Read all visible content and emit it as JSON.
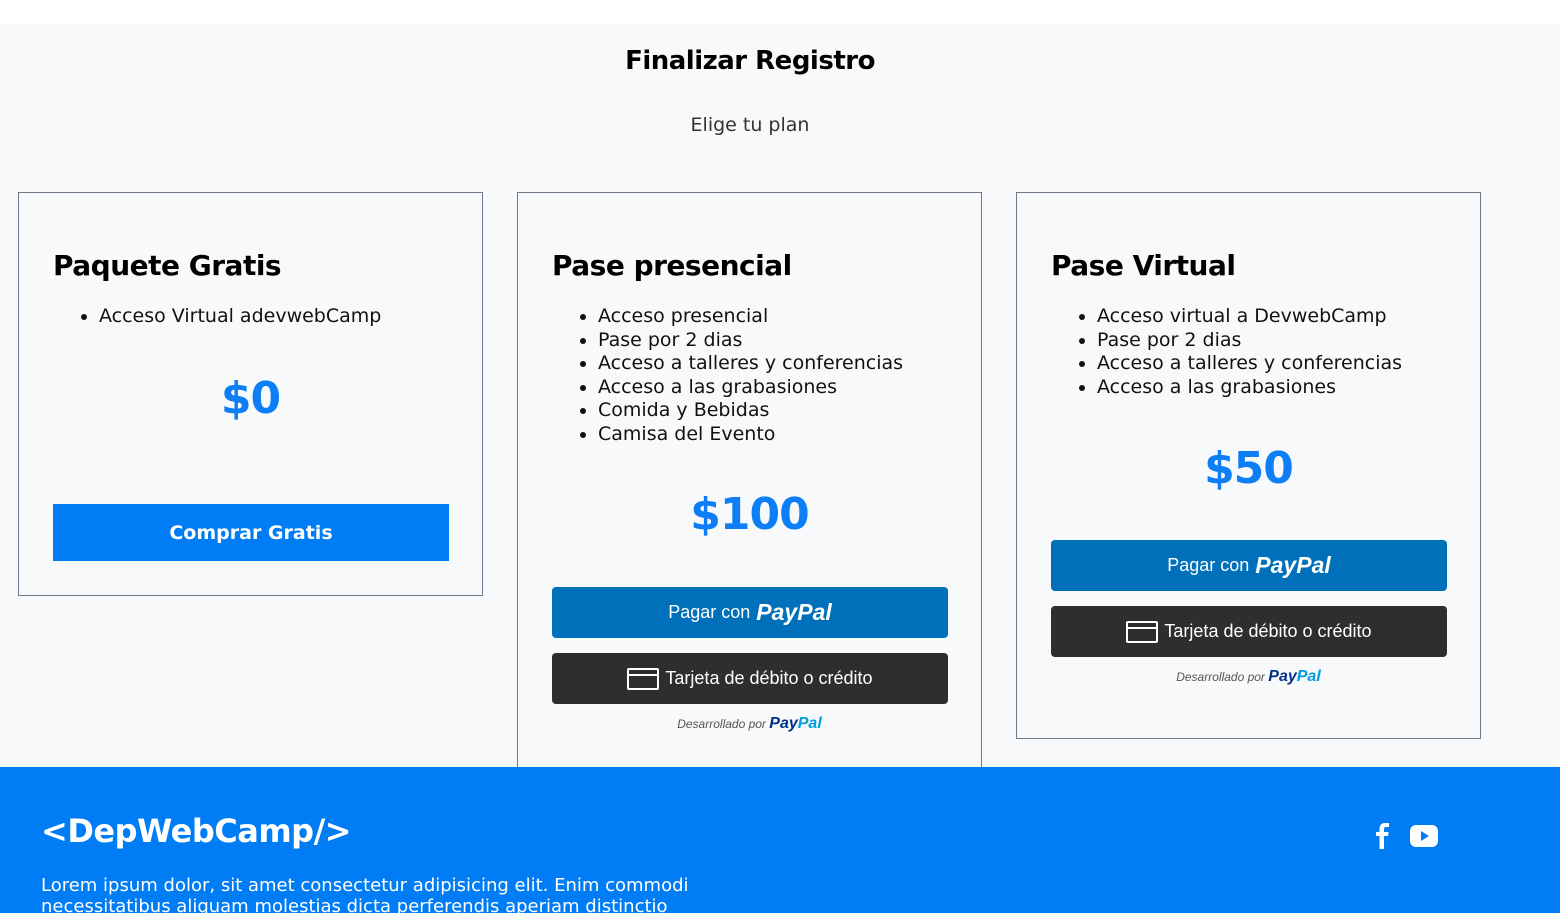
{
  "header": {
    "title": "Finalizar Registro",
    "subtitle": "Elige tu plan"
  },
  "plans": [
    {
      "name": "Paquete Gratis",
      "features": [
        "Acceso Virtual adevwebCamp"
      ],
      "price": "$0",
      "button_label": "Comprar Gratis"
    },
    {
      "name": "Pase presencial",
      "features": [
        "Acceso presencial",
        "Pase por 2 dias",
        "Acceso a talleres y conferencias",
        "Acceso a las grabasiones",
        "Comida y Bebidas",
        "Camisa del Evento"
      ],
      "price": "$100",
      "paypal_label": "Pagar con",
      "paypal_brand_pay": "Pay",
      "paypal_brand_pal": "Pal",
      "card_label": "Tarjeta de débito o crédito",
      "powered_label": "Desarrollado por"
    },
    {
      "name": "Pase Virtual",
      "features": [
        "Acceso virtual a DevwebCamp",
        "Pase por 2 dias",
        "Acceso a talleres y conferencias",
        "Acceso a las grabasiones"
      ],
      "price": "$50",
      "paypal_label": "Pagar con",
      "paypal_brand_pay": "Pay",
      "paypal_brand_pal": "Pal",
      "card_label": "Tarjeta de débito o crédito",
      "powered_label": "Desarrollado por"
    }
  ],
  "footer": {
    "logo": "<DepWebCamp/>",
    "description": "Lorem ipsum dolor, sit amet consectetur adipisicing elit. Enim commodi necessitatibus aliquam molestias dicta perferendis aperiam distinctio sequi",
    "social_icons": [
      "facebook-icon",
      "youtube-icon"
    ]
  },
  "colors": {
    "accent": "#007df4",
    "paypal_blue": "#0070ba",
    "card_button": "#2c2e2f",
    "background": "#f7f9fb"
  }
}
